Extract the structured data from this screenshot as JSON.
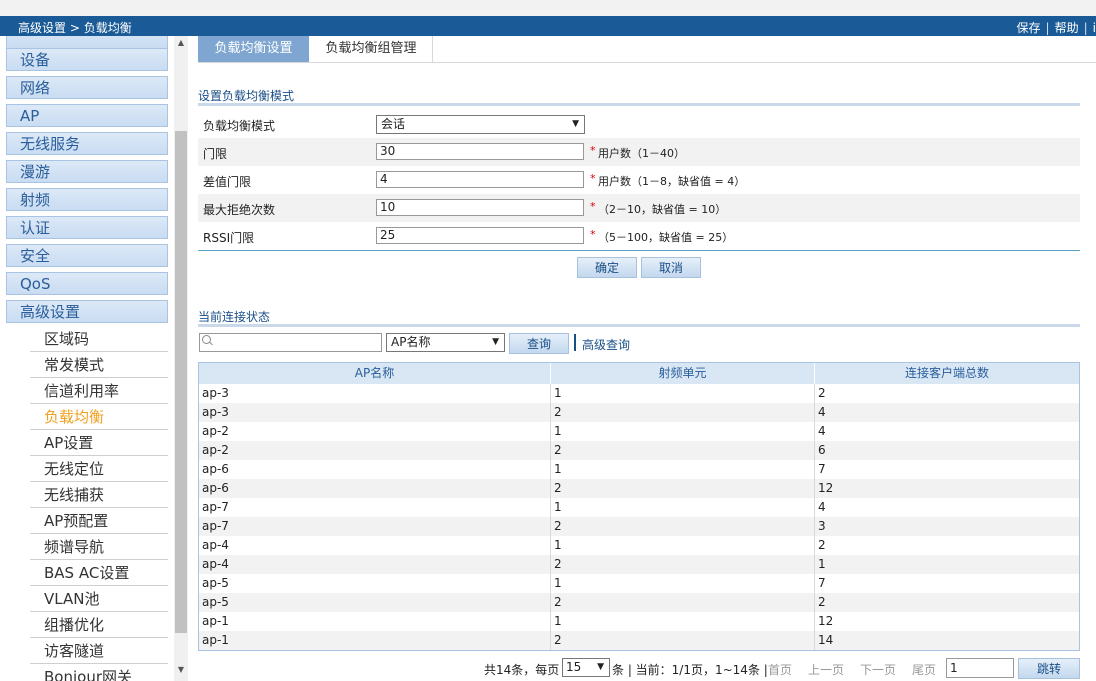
{
  "header": {
    "breadcrumb_section": "高级设置",
    "breadcrumb_sep": ">",
    "breadcrumb_page": "负载均衡",
    "save": "保存",
    "help": "帮助",
    "cut_off": "i"
  },
  "sidebar": {
    "menu": [
      "设备",
      "网络",
      "AP",
      "无线服务",
      "漫游",
      "射频",
      "认证",
      "安全",
      "QoS",
      "高级设置"
    ],
    "sub": [
      "区域码",
      "常发模式",
      "信道利用率",
      "负载均衡",
      "AP设置",
      "无线定位",
      "无线捕获",
      "AP预配置",
      "频谱导航",
      "BAS AC设置",
      "VLAN池",
      "组播优化",
      "访客隧道",
      "Bonjour网关"
    ],
    "active_sub": "负载均衡"
  },
  "tabs": [
    "负载均衡设置",
    "负载均衡组管理"
  ],
  "form": {
    "title": "设置负载均衡模式",
    "mode_label": "负载均衡模式",
    "mode_value": "会话",
    "rows": [
      {
        "label": "门限",
        "value": "30",
        "hint": "用户数（1－40）"
      },
      {
        "label": "差值门限",
        "value": "4",
        "hint": "用户数（1－8，缺省值 = 4）"
      },
      {
        "label": "最大拒绝次数",
        "value": "10",
        "hint": "（2－10，缺省值 = 10）"
      },
      {
        "label": "RSSI门限",
        "value": "25",
        "hint": "（5－100，缺省值 = 25）"
      }
    ],
    "required_mark": "*",
    "ok": "确定",
    "cancel": "取消"
  },
  "status": {
    "title": "当前连接状态",
    "search_value": "",
    "field_select": "AP名称",
    "query": "查询",
    "advanced": "高级查询"
  },
  "table": {
    "columns": [
      "AP名称",
      "射频单元",
      "连接客户端总数"
    ],
    "rows": [
      [
        "ap-3",
        "1",
        "2"
      ],
      [
        "ap-3",
        "2",
        "4"
      ],
      [
        "ap-2",
        "1",
        "4"
      ],
      [
        "ap-2",
        "2",
        "6"
      ],
      [
        "ap-6",
        "1",
        "7"
      ],
      [
        "ap-6",
        "2",
        "12"
      ],
      [
        "ap-7",
        "1",
        "4"
      ],
      [
        "ap-7",
        "2",
        "3"
      ],
      [
        "ap-4",
        "1",
        "2"
      ],
      [
        "ap-4",
        "2",
        "1"
      ],
      [
        "ap-5",
        "1",
        "7"
      ],
      [
        "ap-5",
        "2",
        "2"
      ],
      [
        "ap-1",
        "1",
        "12"
      ],
      [
        "ap-1",
        "2",
        "14"
      ]
    ]
  },
  "pager": {
    "total": "共14条，每页",
    "page_size": "15",
    "unit": "条 | 当前：1/1页，1~14条 |",
    "first": "首页",
    "prev": "上一页",
    "next": "下一页",
    "last": "尾页",
    "page_input": "1",
    "jump": "跳转"
  }
}
